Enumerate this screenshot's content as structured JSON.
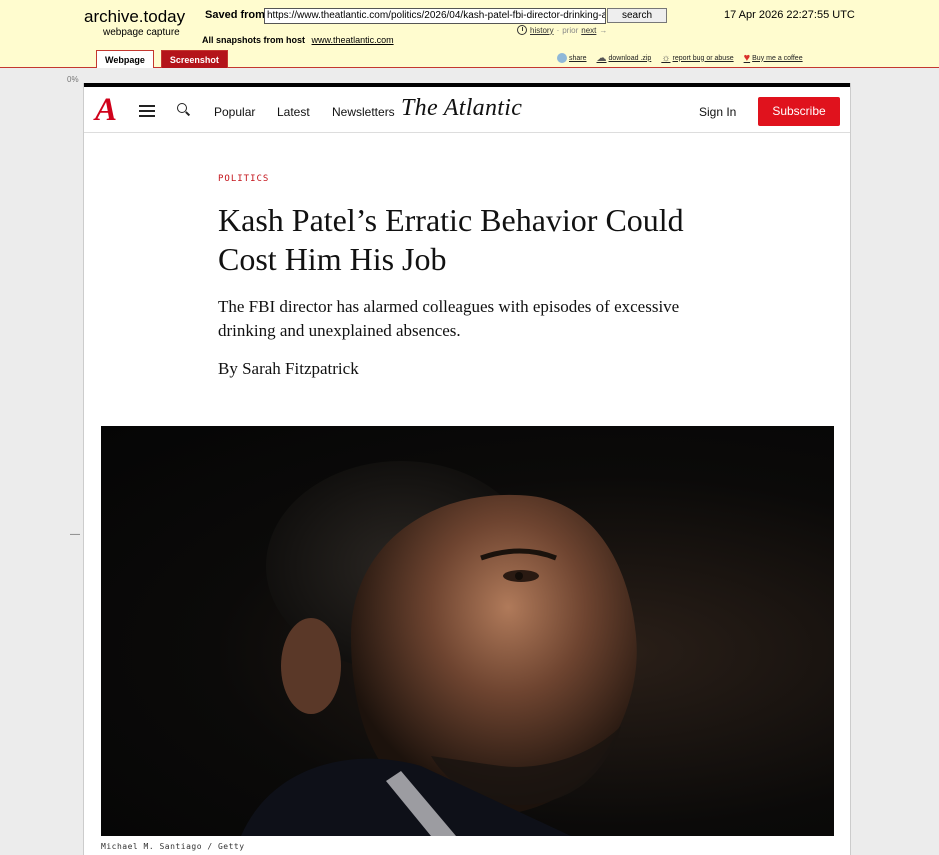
{
  "archive": {
    "brand": "archive.today",
    "subtitle": "webpage capture",
    "saved_from_label": "Saved from",
    "url_value": "https://www.theatlantic.com/politics/2026/04/kash-patel-fbi-director-drinking-a",
    "search_label": "search",
    "history_label": "history",
    "prior_label": "prior",
    "next_label": "next",
    "date": "17 Apr 2026 22:27:55 UTC",
    "all_snapshots_label": "All snapshots",
    "from_host_label": "from host",
    "host_link": "www.theatlantic.com",
    "tabs": [
      {
        "label": "Webpage"
      },
      {
        "label": "Screenshot"
      }
    ],
    "tools": {
      "share": "share",
      "download": "download .zip",
      "report": "report bug or abuse",
      "coffee": "Buy me a coffee"
    },
    "progress_label": "0%",
    "accent_color": "#c4372f",
    "header_bg": "#fffccf"
  },
  "site": {
    "logo_letter": "A",
    "nav": {
      "popular": "Popular",
      "latest": "Latest",
      "newsletters": "Newsletters"
    },
    "wordmark": "The Atlantic",
    "sign_in": "Sign In",
    "subscribe": "Subscribe",
    "brand_color": "#e0121d"
  },
  "article": {
    "section": "POLITICS",
    "headline": "Kash Patel’s Erratic Behavior Could Cost Him His Job",
    "dek": "The FBI director has alarmed colleagues with episodes of excessive drinking and unexplained absences.",
    "byline": "By Sarah Fitzpatrick",
    "photo_caption": "Michael M. Santiago / Getty"
  }
}
